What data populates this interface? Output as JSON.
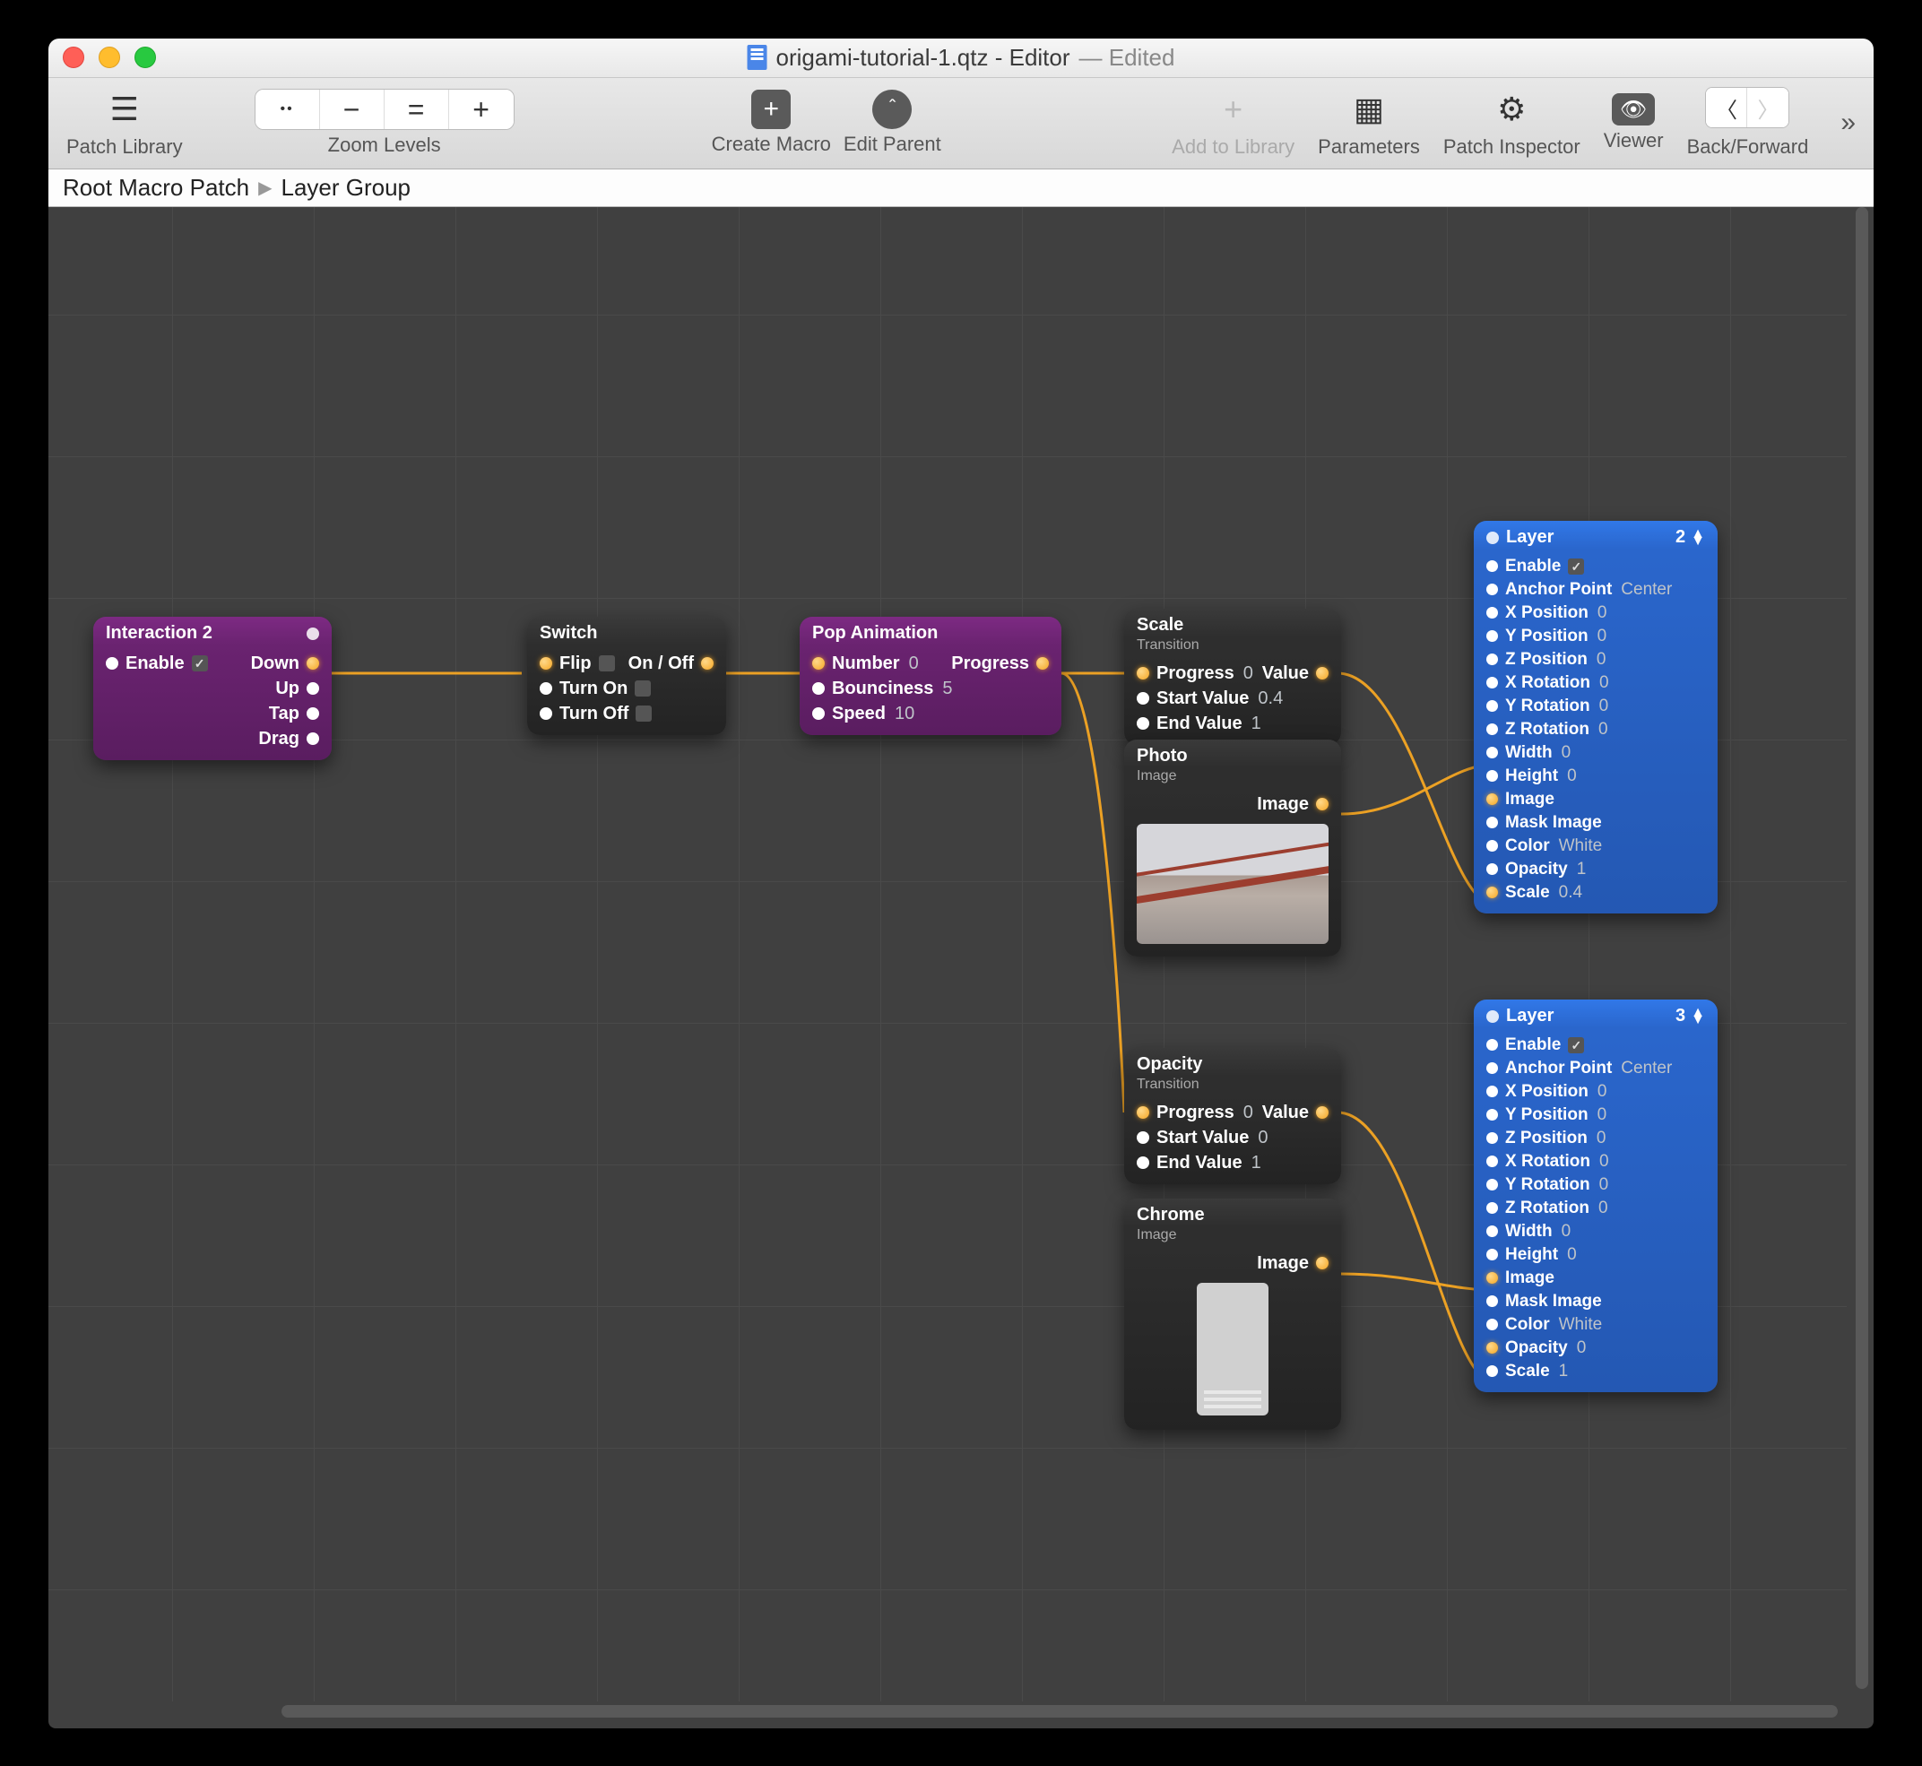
{
  "window": {
    "doc_title": "origami-tutorial-1.qtz - Editor",
    "edited_suffix": "— Edited"
  },
  "toolbar": {
    "patch_library": "Patch Library",
    "zoom_levels": "Zoom Levels",
    "zoom_fit": "••",
    "zoom_out": "−",
    "zoom_actual": "=",
    "zoom_in": "+",
    "create_macro": "Create Macro",
    "edit_parent": "Edit Parent",
    "add_to_library": "Add to Library",
    "parameters": "Parameters",
    "patch_inspector": "Patch Inspector",
    "viewer": "Viewer",
    "back_forward": "Back/Forward"
  },
  "breadcrumb": {
    "root": "Root Macro Patch",
    "current": "Layer Group"
  },
  "nodes": {
    "interaction": {
      "title": "Interaction 2",
      "enable": "Enable",
      "down": "Down",
      "up": "Up",
      "tap": "Tap",
      "drag": "Drag"
    },
    "switch": {
      "title": "Switch",
      "flip": "Flip",
      "turn_on": "Turn On",
      "turn_off": "Turn Off",
      "onoff": "On / Off"
    },
    "pop": {
      "title": "Pop Animation",
      "number": "Number",
      "number_v": "0",
      "bounciness": "Bounciness",
      "bounciness_v": "5",
      "speed": "Speed",
      "speed_v": "10",
      "progress": "Progress"
    },
    "scale": {
      "title": "Scale",
      "sub": "Transition",
      "progress": "Progress",
      "progress_v": "0",
      "start": "Start Value",
      "start_v": "0.4",
      "end": "End Value",
      "end_v": "1",
      "value": "Value"
    },
    "photo": {
      "title": "Photo",
      "sub": "Image",
      "image": "Image"
    },
    "opacity": {
      "title": "Opacity",
      "sub": "Transition",
      "progress": "Progress",
      "progress_v": "0",
      "start": "Start Value",
      "start_v": "0",
      "end": "End Value",
      "end_v": "1",
      "value": "Value"
    },
    "chrome": {
      "title": "Chrome",
      "sub": "Image",
      "image": "Image"
    },
    "layer2": {
      "title": "Layer",
      "index": "2",
      "enable": "Enable",
      "anchor": "Anchor Point",
      "anchor_v": "Center",
      "xpos": "X Position",
      "xpos_v": "0",
      "ypos": "Y Position",
      "ypos_v": "0",
      "zpos": "Z Position",
      "zpos_v": "0",
      "xrot": "X Rotation",
      "xrot_v": "0",
      "yrot": "Y Rotation",
      "yrot_v": "0",
      "zrot": "Z Rotation",
      "zrot_v": "0",
      "width": "Width",
      "width_v": "0",
      "height": "Height",
      "height_v": "0",
      "image": "Image",
      "mask": "Mask Image",
      "color": "Color",
      "color_v": "White",
      "opacity": "Opacity",
      "opacity_v": "1",
      "scale": "Scale",
      "scale_v": "0.4"
    },
    "layer3": {
      "title": "Layer",
      "index": "3",
      "enable": "Enable",
      "anchor": "Anchor Point",
      "anchor_v": "Center",
      "xpos": "X Position",
      "xpos_v": "0",
      "ypos": "Y Position",
      "ypos_v": "0",
      "zpos": "Z Position",
      "zpos_v": "0",
      "xrot": "X Rotation",
      "xrot_v": "0",
      "yrot": "Y Rotation",
      "yrot_v": "0",
      "zrot": "Z Rotation",
      "zrot_v": "0",
      "width": "Width",
      "width_v": "0",
      "height": "Height",
      "height_v": "0",
      "image": "Image",
      "mask": "Mask Image",
      "color": "Color",
      "color_v": "White",
      "opacity": "Opacity",
      "opacity_v": "0",
      "scale": "Scale",
      "scale_v": "1"
    }
  }
}
